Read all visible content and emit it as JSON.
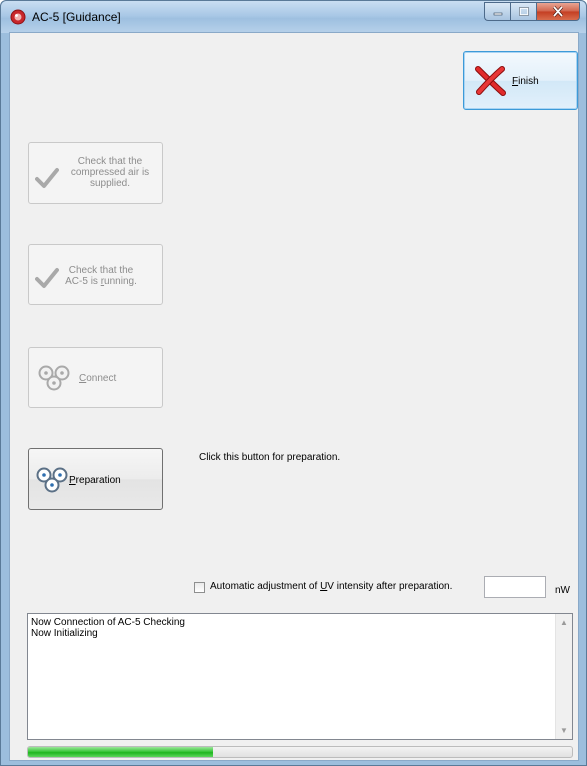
{
  "window": {
    "title": "AC-5 [Guidance]",
    "controls": [
      "minimize",
      "maximize",
      "close"
    ]
  },
  "buttons": {
    "finish": {
      "label_prefix": "",
      "mnemonic": "F",
      "label_rest": "inish",
      "icon": "red-x-icon",
      "enabled": true
    },
    "check_air": {
      "lines": [
        "Check that the",
        "compressed air is",
        "supplied."
      ],
      "icon": "checkmark-icon",
      "enabled": false
    },
    "check_running": {
      "line1": "Check that the",
      "line2_prefix": "AC-5 is ",
      "line2_mnemonic": "r",
      "line2_rest": "unning.",
      "icon": "checkmark-icon",
      "enabled": false
    },
    "connect": {
      "mnemonic": "C",
      "label_rest": "onnect",
      "icon": "connect-icon",
      "enabled": false
    },
    "preparation": {
      "mnemonic": "P",
      "label_rest": "reparation",
      "icon": "preparation-icon",
      "enabled": true
    }
  },
  "hint": "Click this button for preparation.",
  "auto_adjust": {
    "label_prefix": "Automatic adjustment of ",
    "mnemonic": "U",
    "label_rest": "V intensity after preparation.",
    "checked": false,
    "value": "",
    "unit": "nW"
  },
  "log": {
    "lines": [
      "Now Connection of AC-5 Checking",
      "Now Initializing"
    ]
  },
  "progress": {
    "fraction": 0.34
  },
  "colors": {
    "progress": "#1fb51f",
    "finish_x": "#d21f1f",
    "title_bar": "#a9c8e6",
    "close_button": "#c43d22"
  }
}
